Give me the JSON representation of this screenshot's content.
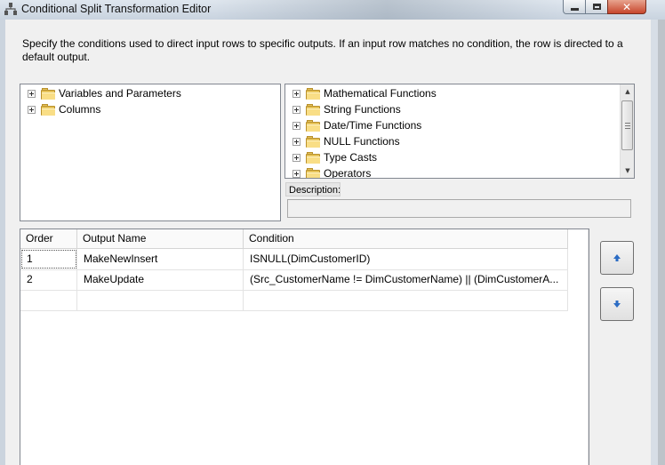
{
  "window": {
    "title": "Conditional Split Transformation Editor"
  },
  "intro_text": "Specify the conditions used to direct input rows to specific outputs. If an input row matches no condition, the row is directed to a default output.",
  "left_tree": [
    {
      "label": "Variables and Parameters"
    },
    {
      "label": "Columns"
    }
  ],
  "right_tree": [
    {
      "label": "Mathematical Functions"
    },
    {
      "label": "String Functions"
    },
    {
      "label": "Date/Time Functions"
    },
    {
      "label": "NULL Functions"
    },
    {
      "label": "Type Casts"
    },
    {
      "label": "Operators"
    }
  ],
  "description": {
    "label": "Description:",
    "value": ""
  },
  "grid": {
    "columns": [
      "Order",
      "Output Name",
      "Condition"
    ],
    "rows": [
      {
        "order": "1",
        "output_name": "MakeNewInsert",
        "condition": "ISNULL(DimCustomerID)"
      },
      {
        "order": "2",
        "output_name": "MakeUpdate",
        "condition": "(Src_CustomerName != DimCustomerName) || (DimCustomerA..."
      }
    ]
  },
  "icons": {
    "move_up": "arrow-up-icon",
    "move_down": "arrow-down-icon",
    "close": "close-icon",
    "minimize": "minimize-icon",
    "maximize": "maximize-icon",
    "folder": "folder-icon"
  },
  "colors": {
    "arrow_blue": "#2b6cc4",
    "folder": "#e7c45a"
  }
}
